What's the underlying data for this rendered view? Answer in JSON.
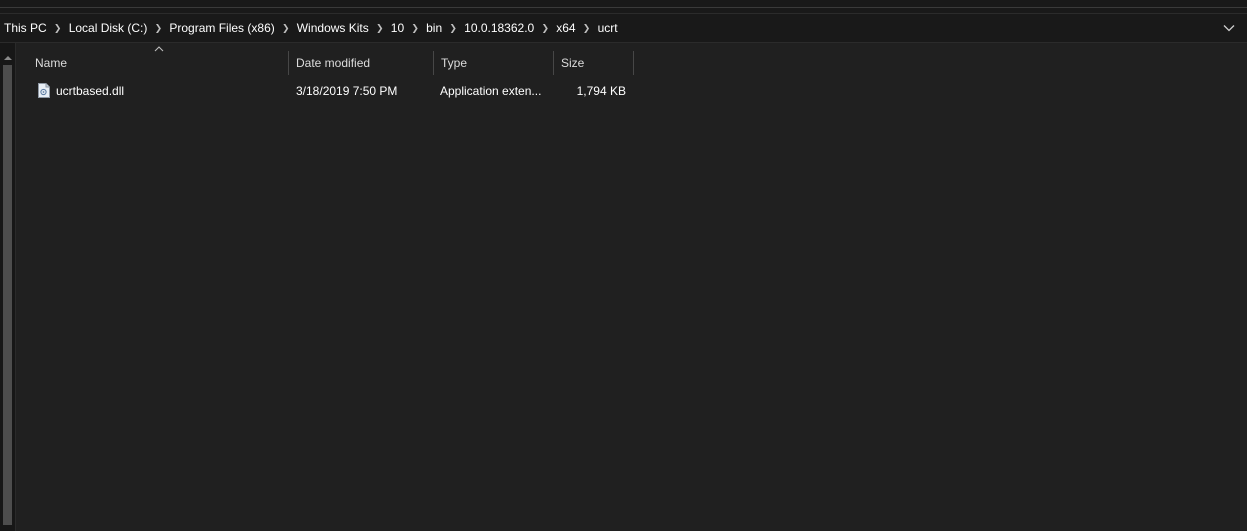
{
  "breadcrumb": {
    "items": [
      "This PC",
      "Local Disk (C:)",
      "Program Files (x86)",
      "Windows Kits",
      "10",
      "bin",
      "10.0.18362.0",
      "x64",
      "ucrt"
    ]
  },
  "columns": {
    "name": "Name",
    "date_modified": "Date modified",
    "type": "Type",
    "size": "Size"
  },
  "files": [
    {
      "name": "ucrtbased.dll",
      "date_modified": "3/18/2019 7:50 PM",
      "type": "Application exten...",
      "size": "1,794 KB",
      "icon": "dll-file-icon"
    }
  ],
  "colors": {
    "background": "#202020",
    "address_bar": "#191919",
    "text": "#ffffff"
  }
}
